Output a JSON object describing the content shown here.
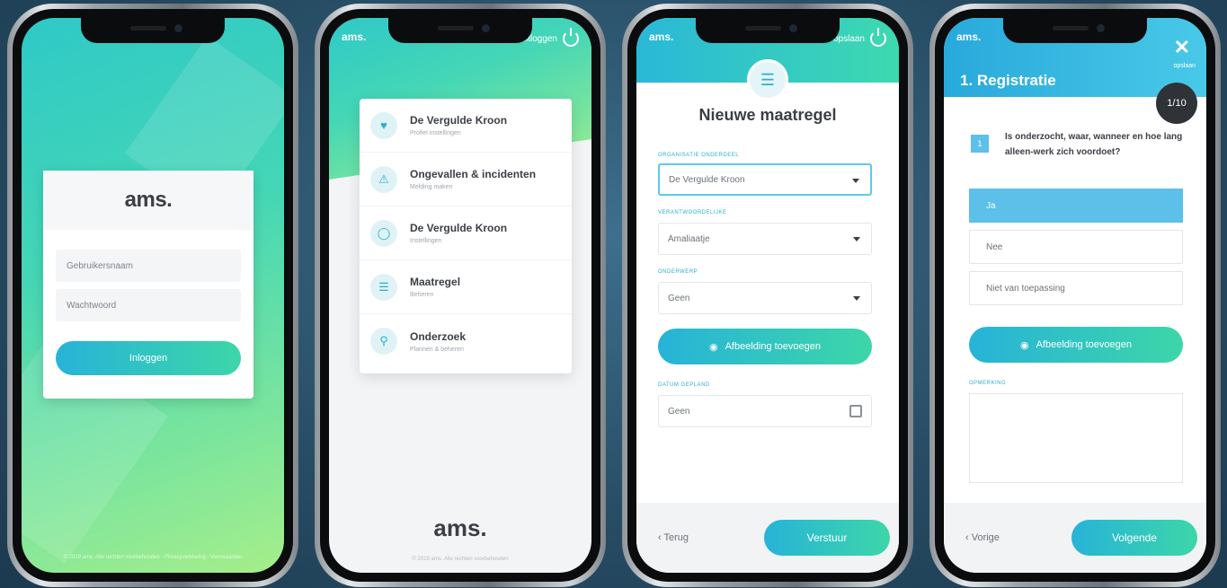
{
  "login": {
    "logo": "ams.",
    "username_placeholder": "Gebruikersnaam",
    "password_placeholder": "Wachtwoord",
    "login_button": "Inloggen",
    "footer": "© 2019 ams. Alle rechten voorbehouden · Privacyverklaring · Voorwaarden"
  },
  "menu": {
    "brand": "ams.",
    "topbar_right": "uitloggen",
    "items": [
      {
        "title": "De Vergulde Kroon",
        "subtitle": "Profiel instellingen",
        "icon": "shield-icon"
      },
      {
        "title": "Ongevallen & incidenten",
        "subtitle": "Melding maken",
        "icon": "warning-icon"
      },
      {
        "title": "De Vergulde Kroon",
        "subtitle": "Instellingen",
        "icon": "chat-icon"
      },
      {
        "title": "Maatregel",
        "subtitle": "Beheren",
        "icon": "list-icon"
      },
      {
        "title": "Onderzoek",
        "subtitle": "Plannen & beheren",
        "icon": "search-icon"
      }
    ],
    "bottom_logo": "ams.",
    "footer": "© 2019 ams. Alle rechten voorbehouden"
  },
  "form": {
    "brand": "ams.",
    "topbar_right": "opslaan",
    "title": "Nieuwe maatregel",
    "fields": [
      {
        "label": "ORGANISATIE ONDERDEEL",
        "value": "De Vergulde Kroon"
      },
      {
        "label": "VERANTWOORDELIJKE",
        "value": "Amaliaatje"
      },
      {
        "label": "ONDERWERP",
        "value": "Geen"
      }
    ],
    "image_button": "Afbeelding toevoegen",
    "date_label": "DATUM GEPLAND",
    "date_value": "Geen",
    "back": "‹ Terug",
    "submit": "Verstuur"
  },
  "survey": {
    "brand": "ams.",
    "title": "1. Registratie",
    "close_label": "opslaan",
    "counter": "1/10",
    "question_number": "1",
    "question": "Is onderzocht, waar, wanneer en hoe lang alleen-werk zich voordoet?",
    "options": [
      "Ja",
      "Nee",
      "Niet van toepassing"
    ],
    "image_button": "Afbeelding toevoegen",
    "remark_label": "OPMERKING",
    "previous": "‹ Vorige",
    "next": "Volgende"
  },
  "colors": {
    "accent_blue": "#2ab8d8",
    "accent_green": "#3dd9b0",
    "selected": "#5cc0e8"
  }
}
